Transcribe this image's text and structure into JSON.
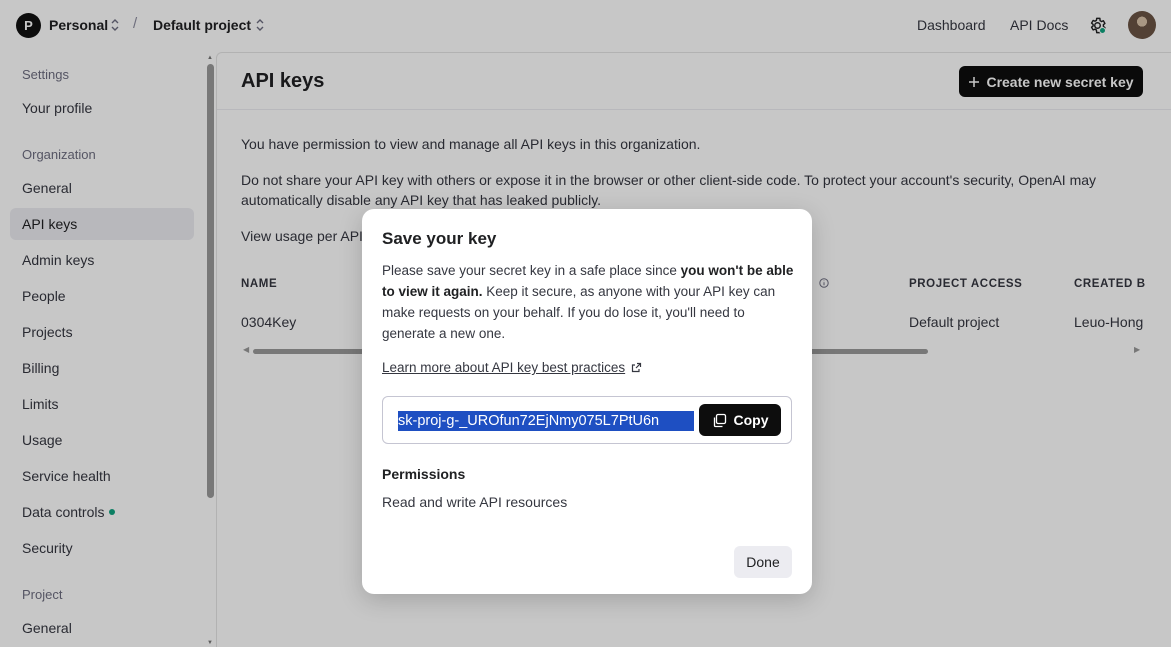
{
  "topbar": {
    "org_initial": "P",
    "org_name": "Personal",
    "separator": "/",
    "project_name": "Default project",
    "links": [
      "Dashboard",
      "API Docs"
    ]
  },
  "sidebar": {
    "settings_heading": "Settings",
    "your_profile": "Your profile",
    "organization_heading": "Organization",
    "org_items": [
      "General",
      "API keys",
      "Admin keys",
      "People",
      "Projects",
      "Billing",
      "Limits",
      "Usage",
      "Service health",
      "Data controls",
      "Security"
    ],
    "active_item": "API keys",
    "project_heading": "Project",
    "project_items": [
      "General"
    ]
  },
  "main": {
    "title": "API keys",
    "create_button": "Create new secret key",
    "permission_text": "You have permission to view and manage all API keys in this organization.",
    "warning_line1": "Do not share your API key with others or expose it in the browser or other client-side code. To protect your account's security, OpenAI may",
    "warning_line2": "automatically disable any API key that has leaked publicly.",
    "usage_text": "View usage per API",
    "table": {
      "headers": [
        "NAME",
        "PROJECT ACCESS",
        "CREATED B"
      ],
      "rows": [
        {
          "name": "0304Key",
          "project_access": "Default project",
          "created_by": "Leuo-Hong"
        }
      ]
    }
  },
  "modal": {
    "title": "Save your key",
    "text_before_bold": "Please save your secret key in a safe place since ",
    "bold_text": "you won't be able to view it again.",
    "text_after_bold": " Keep it secure, as anyone with your API key can make requests on your behalf. If you do lose it, you'll need to generate a new one.",
    "learn_link": "Learn more about API key best practices",
    "secret_key": "sk-proj-g-_UROfun72EjNmy075L7PtU6n",
    "copy_button": "Copy",
    "permissions_heading": "Permissions",
    "permissions_value": "Read and write API resources",
    "done_button": "Done"
  },
  "colors": {
    "accent_green": "#10a37f",
    "selection_blue": "#1e4fc2",
    "button_dark": "#0d0d0d"
  }
}
